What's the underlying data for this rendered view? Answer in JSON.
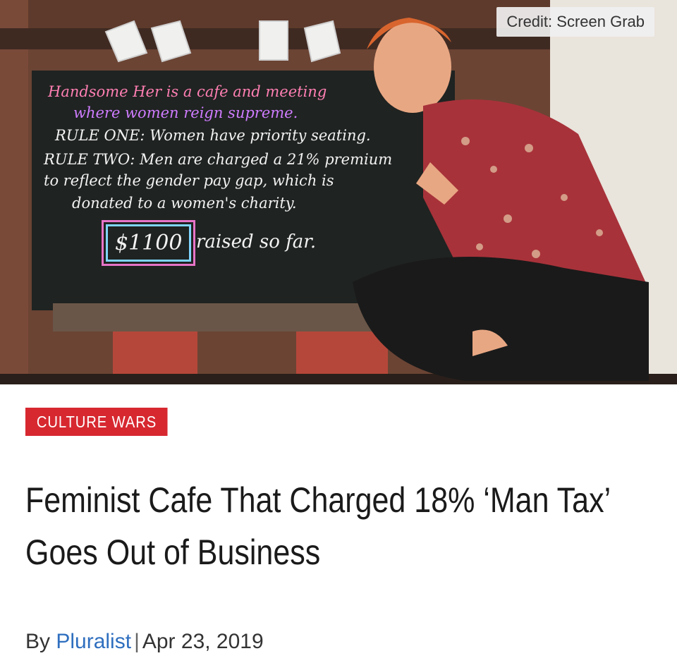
{
  "hero": {
    "credit": "Credit: Screen Grab",
    "chalkboard": {
      "line1": "Handsome Her is a cafe and meeting",
      "line2": "where women reign supreme.",
      "line3": "RULE ONE: Women have priority seating.",
      "line4": "RULE TWO: Men are charged a 21% premium",
      "line5": "to reflect the gender pay gap, which is",
      "line6": "donated to a women's charity.",
      "raised_amount": "$1100",
      "raised_text": "raised so far."
    }
  },
  "article": {
    "category": "CULTURE WARS",
    "headline": "Feminist Cafe That Charged 18% ‘Man Tax’ Goes Out of Business",
    "by_label": "By",
    "author": "Pluralist",
    "separator": "|",
    "date": "Apr 23, 2019"
  },
  "colors": {
    "tag_background": "#d72830",
    "author_link": "#2f6fbf"
  }
}
